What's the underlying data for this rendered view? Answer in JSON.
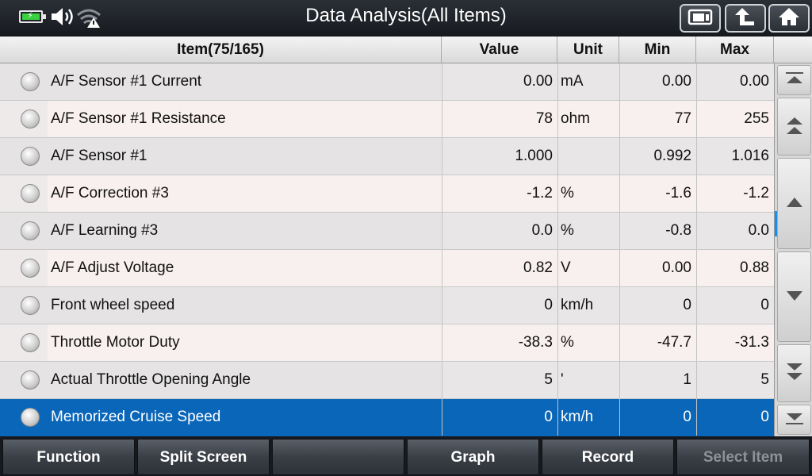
{
  "header": {
    "title": "Data Analysis(All Items)",
    "icons": [
      "battery-charging-icon",
      "speaker-icon",
      "wifi-warning-icon",
      "screenshot-icon",
      "back-up-arrow-icon",
      "home-icon"
    ]
  },
  "table": {
    "columns": [
      "Item(75/165)",
      "Value",
      "Unit",
      "Min",
      "Max"
    ],
    "rows": [
      {
        "name": "A/F Sensor #1 Current",
        "value": "0.00",
        "unit": "mA",
        "min": "0.00",
        "max": "0.00"
      },
      {
        "name": "A/F Sensor #1 Resistance",
        "value": "78",
        "unit": "ohm",
        "min": "77",
        "max": "255"
      },
      {
        "name": "A/F Sensor #1",
        "value": "1.000",
        "unit": "",
        "min": "0.992",
        "max": "1.016"
      },
      {
        "name": "A/F Correction #3",
        "value": "-1.2",
        "unit": "%",
        "min": "-1.6",
        "max": "-1.2"
      },
      {
        "name": "A/F Learning #3",
        "value": "0.0",
        "unit": "%",
        "min": "-0.8",
        "max": "0.0"
      },
      {
        "name": "A/F Adjust Voltage",
        "value": "0.82",
        "unit": "V",
        "min": "0.00",
        "max": "0.88"
      },
      {
        "name": "Front wheel speed",
        "value": "0",
        "unit": "km/h",
        "min": "0",
        "max": "0"
      },
      {
        "name": "Throttle Motor Duty",
        "value": "-38.3",
        "unit": "%",
        "min": "-47.7",
        "max": "-31.3"
      },
      {
        "name": "Actual Throttle Opening Angle",
        "value": "5",
        "unit": "'",
        "min": "1",
        "max": "5"
      },
      {
        "name": "Memorized Cruise Speed",
        "value": "0",
        "unit": "km/h",
        "min": "0",
        "max": "0"
      }
    ],
    "selected_index": 9
  },
  "colors": {
    "selected_row": "#0a66b8",
    "scroll_indicator": "#1e8fe6",
    "battery_fill": "#39d13f"
  },
  "footer": {
    "buttons": [
      "Function",
      "Split Screen",
      "",
      "Graph",
      "Record",
      "Select Item"
    ]
  }
}
